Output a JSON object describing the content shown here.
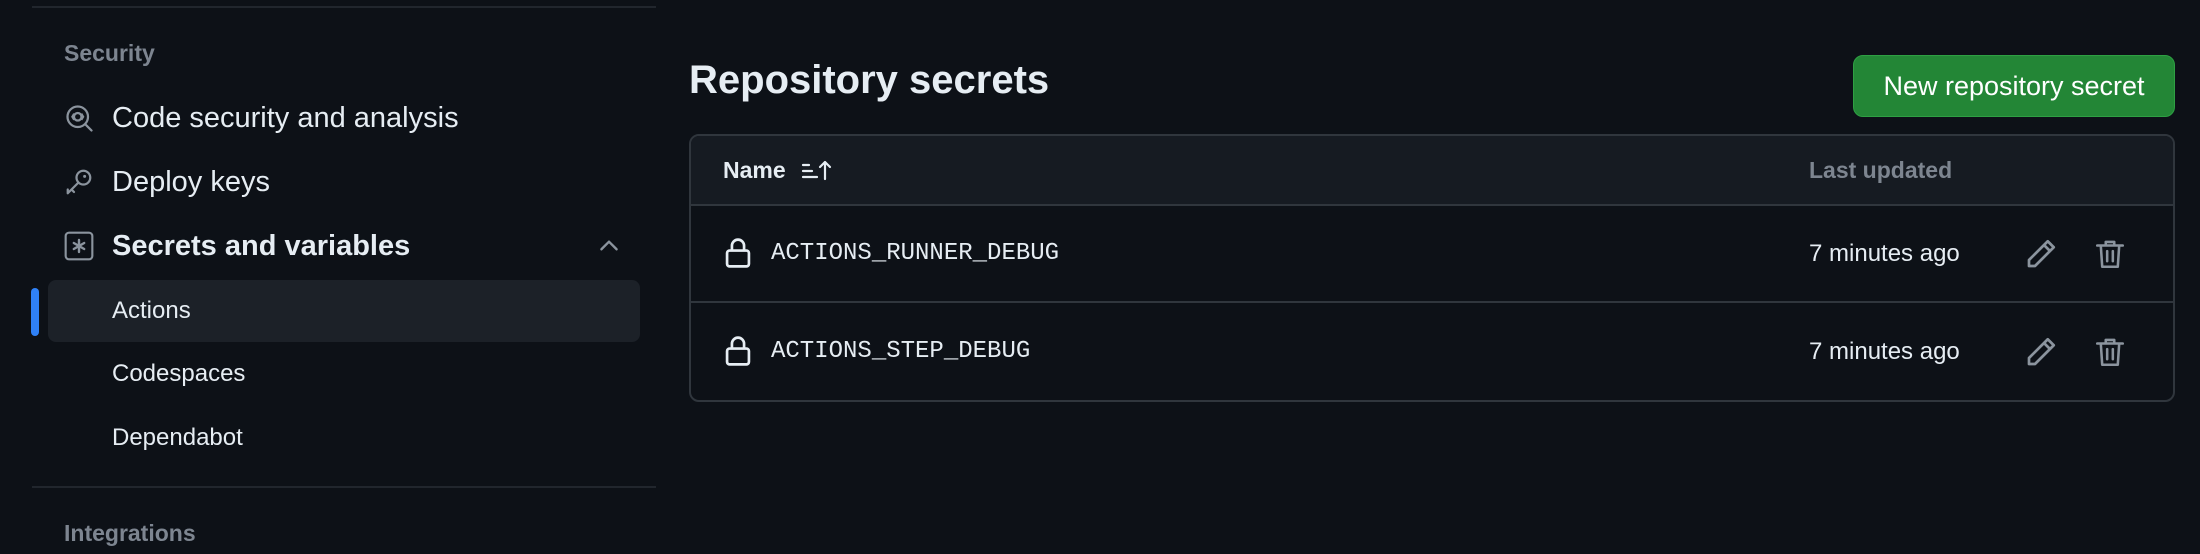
{
  "sidebar": {
    "security_title": "Security",
    "items": [
      {
        "label": "Code security and analysis",
        "icon": "codescan-icon"
      },
      {
        "label": "Deploy keys",
        "icon": "key-icon"
      },
      {
        "label": "Secrets and variables",
        "icon": "asterisk-icon",
        "expanded": true
      }
    ],
    "sub_items": [
      {
        "label": "Actions",
        "active": true
      },
      {
        "label": "Codespaces"
      },
      {
        "label": "Dependabot"
      }
    ],
    "integrations_title": "Integrations"
  },
  "main": {
    "title": "Repository secrets",
    "new_button_label": "New repository secret",
    "table": {
      "col_name": "Name",
      "col_updated": "Last updated",
      "rows": [
        {
          "name": "ACTIONS_RUNNER_DEBUG",
          "updated": "7 minutes ago"
        },
        {
          "name": "ACTIONS_STEP_DEBUG",
          "updated": "7 minutes ago"
        }
      ]
    }
  },
  "colors": {
    "background": "#0d1117",
    "accent": "#2f81f7",
    "primary_button": "#238636",
    "muted_text": "#7d8590"
  }
}
